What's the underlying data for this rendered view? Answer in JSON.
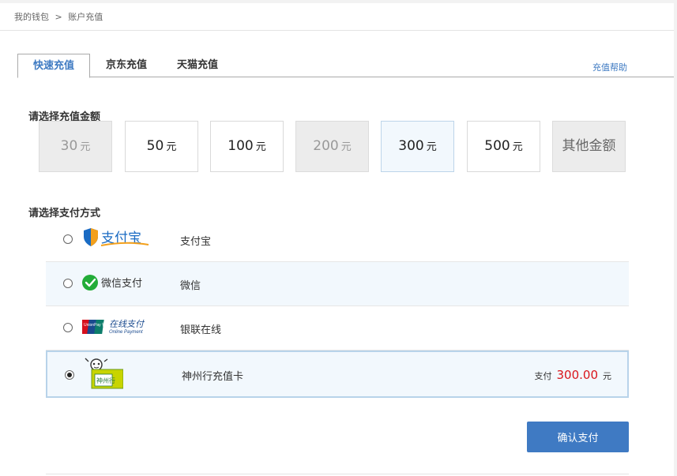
{
  "breadcrumb": {
    "wallet": "我的钱包",
    "separator": ">",
    "current": "账户充值"
  },
  "tabs": [
    {
      "label": "快速充值",
      "active": true
    },
    {
      "label": "京东充值",
      "active": false
    },
    {
      "label": "天猫充值",
      "active": false
    }
  ],
  "help_link": "充值帮助",
  "amount_section": {
    "title": "请选择充值金额",
    "unit": "元",
    "options": [
      {
        "value": "30",
        "state": "disabled"
      },
      {
        "value": "50",
        "state": "normal"
      },
      {
        "value": "100",
        "state": "normal"
      },
      {
        "value": "200",
        "state": "disabled"
      },
      {
        "value": "300",
        "state": "hover"
      },
      {
        "value": "500",
        "state": "normal"
      }
    ],
    "other_label": "其他金额"
  },
  "payment_section": {
    "title": "请选择支付方式",
    "methods": [
      {
        "logo_text": "支付宝",
        "label": "支付宝",
        "selected": false
      },
      {
        "logo_text": "微信支付",
        "label": "微信",
        "selected": false
      },
      {
        "logo_text": "在线支付",
        "logo_sub": "Online Payment",
        "logo_brand": "UnionPay 银联",
        "label": "银联在线",
        "selected": false
      },
      {
        "logo_text": "神州行",
        "label": "神州行充值卡",
        "selected": true
      }
    ],
    "pay_prefix": "支付",
    "pay_amount": "300.00",
    "pay_unit": "元"
  },
  "confirm_button": "确认支付",
  "colors": {
    "accent": "#3f7ac3",
    "price": "#d9151b",
    "selected_bg": "#f2f8fd"
  }
}
